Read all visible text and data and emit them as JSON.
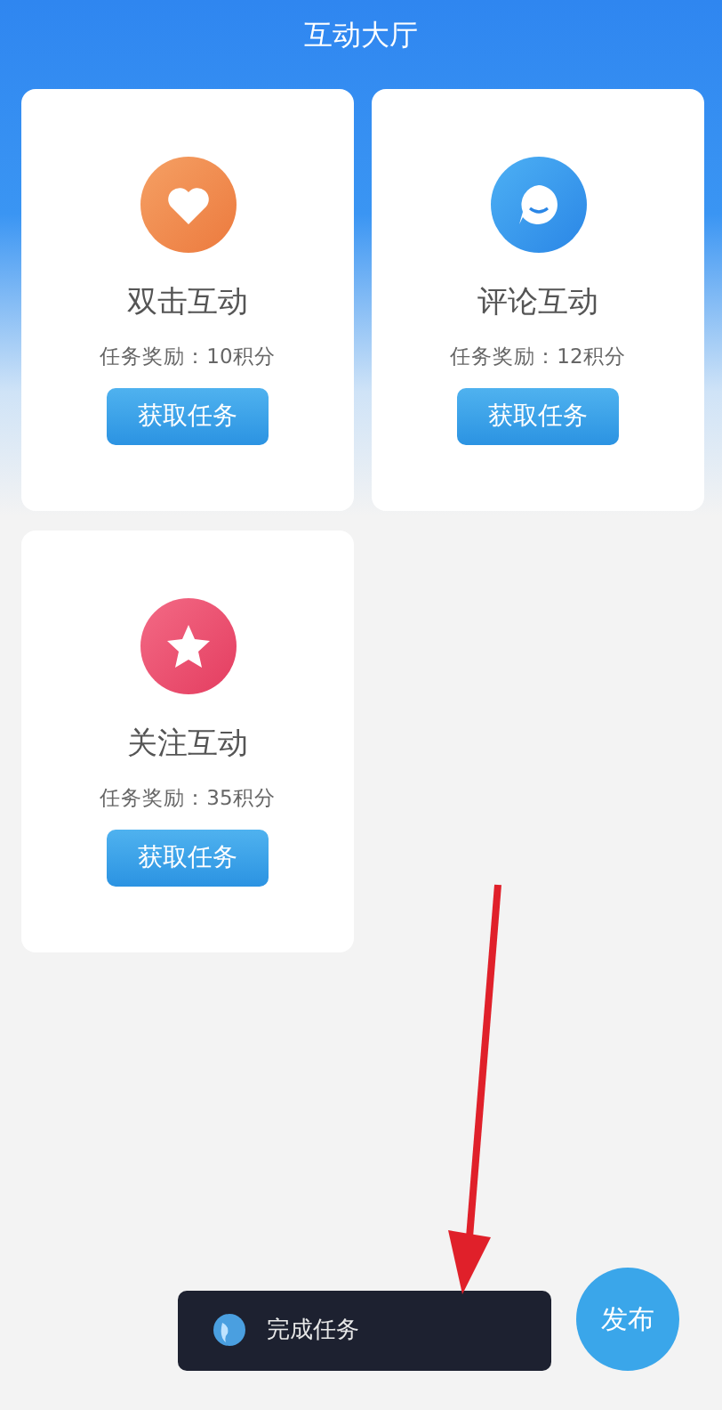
{
  "header": {
    "title": "互动大厅"
  },
  "tasks": [
    {
      "kind": "like",
      "name": "双击互动",
      "reward": "任务奖励：10积分",
      "button": "获取任务"
    },
    {
      "kind": "comment",
      "name": "评论互动",
      "reward": "任务奖励：12积分",
      "button": "获取任务"
    },
    {
      "kind": "follow",
      "name": "关注互动",
      "reward": "任务奖励：35积分",
      "button": "获取任务"
    }
  ],
  "toast": {
    "text": "完成任务"
  },
  "publish_button": {
    "label": "发布"
  }
}
